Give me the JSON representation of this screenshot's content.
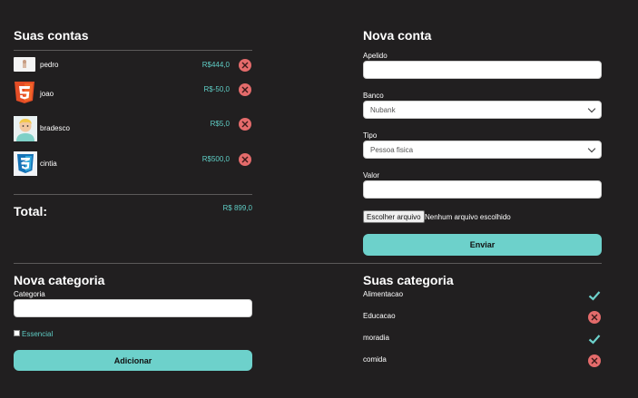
{
  "accounts_section": {
    "title": "Suas contas",
    "items": [
      {
        "name": "pedro",
        "value": "R$444,0",
        "logo": "generic-bank-icon"
      },
      {
        "name": "joao",
        "value": "R$-50,0",
        "logo": "html5-icon"
      },
      {
        "name": "bradesco",
        "value": "R$5,0",
        "logo": "avatar-icon"
      },
      {
        "name": "cintia",
        "value": "R$500,0",
        "logo": "css3-icon"
      }
    ],
    "total_label": "Total:",
    "total_value": "R$ 899,0"
  },
  "new_account": {
    "title": "Nova conta",
    "nickname_label": "Apelido",
    "nickname_value": "",
    "bank_label": "Banco",
    "bank_selected": "Nubank",
    "type_label": "Tipo",
    "type_selected": "Pessoa fisica",
    "value_label": "Valor",
    "value_value": "",
    "file_button": "Escolher arquivo",
    "file_status": "Nenhum arquivo escolhido",
    "submit_label": "Enviar"
  },
  "new_category": {
    "title": "Nova categoria",
    "category_label": "Categoria",
    "category_value": "",
    "essential_label": "Essencial",
    "add_label": "Adicionar"
  },
  "categories": {
    "title": "Suas categoria",
    "items": [
      {
        "name": "Alimentacao",
        "essential": true
      },
      {
        "name": "Educacao",
        "essential": false
      },
      {
        "name": "moradia",
        "essential": true
      },
      {
        "name": "comida",
        "essential": false
      }
    ]
  },
  "colors": {
    "background": "#211f20",
    "accent": "#6dd1cb",
    "danger": "#e46b6b"
  }
}
